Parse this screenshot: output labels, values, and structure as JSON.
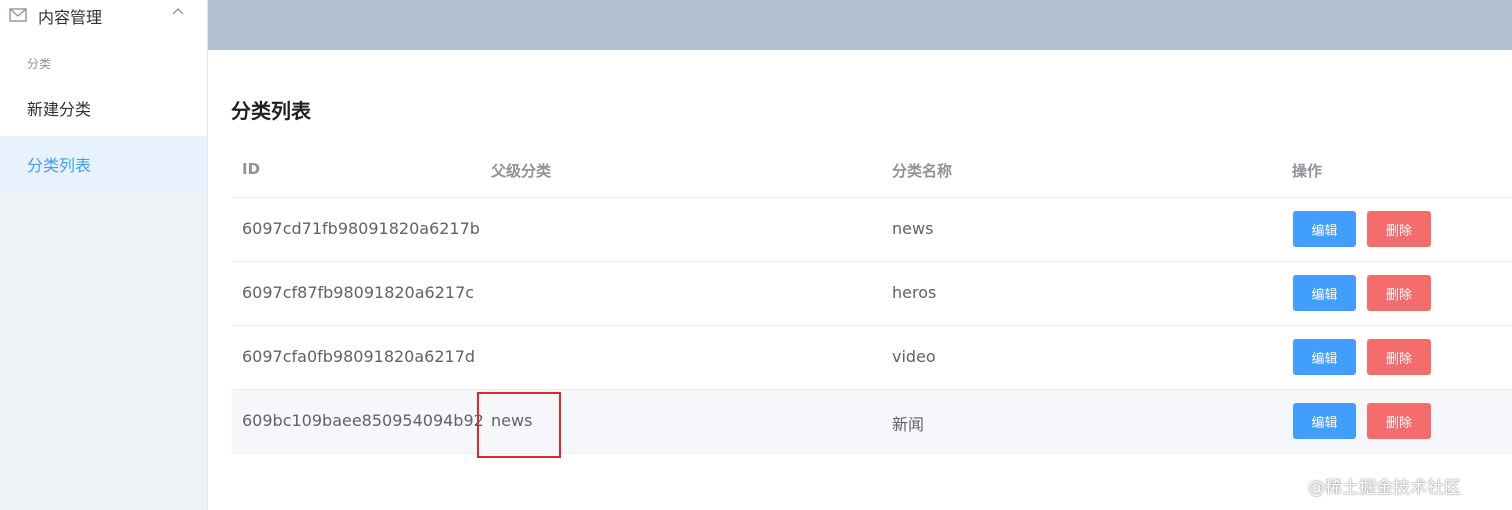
{
  "sidebar": {
    "submenu_title": "内容管理",
    "group_title": "分类",
    "items": [
      {
        "label": "新建分类",
        "active": false
      },
      {
        "label": "分类列表",
        "active": true
      }
    ]
  },
  "main": {
    "title": "分类列表",
    "table": {
      "columns": [
        "ID",
        "父级分类",
        "分类名称",
        "操作"
      ],
      "rows": [
        {
          "id": "6097cd71fb98091820a6217b",
          "parent": "",
          "name": "news"
        },
        {
          "id": "6097cf87fb98091820a6217c",
          "parent": "",
          "name": "heros"
        },
        {
          "id": "6097cfa0fb98091820a6217d",
          "parent": "",
          "name": "video"
        },
        {
          "id": "609bc109baee850954094b92",
          "parent": "news",
          "name": "新闻"
        }
      ],
      "edit_label": "编辑",
      "delete_label": "删除"
    }
  },
  "watermark": "@稀土掘金技术社区",
  "colors": {
    "primary": "#409eff",
    "danger": "#f56c6c",
    "header": "#b3c0d1",
    "sidebar_bg": "#eef1f6",
    "active_item_bg": "#e8f2fd",
    "annotation_border": "#e0282b"
  },
  "icons": {
    "submenu": "mail-icon",
    "submenu_toggle": "chevron-up-icon"
  }
}
